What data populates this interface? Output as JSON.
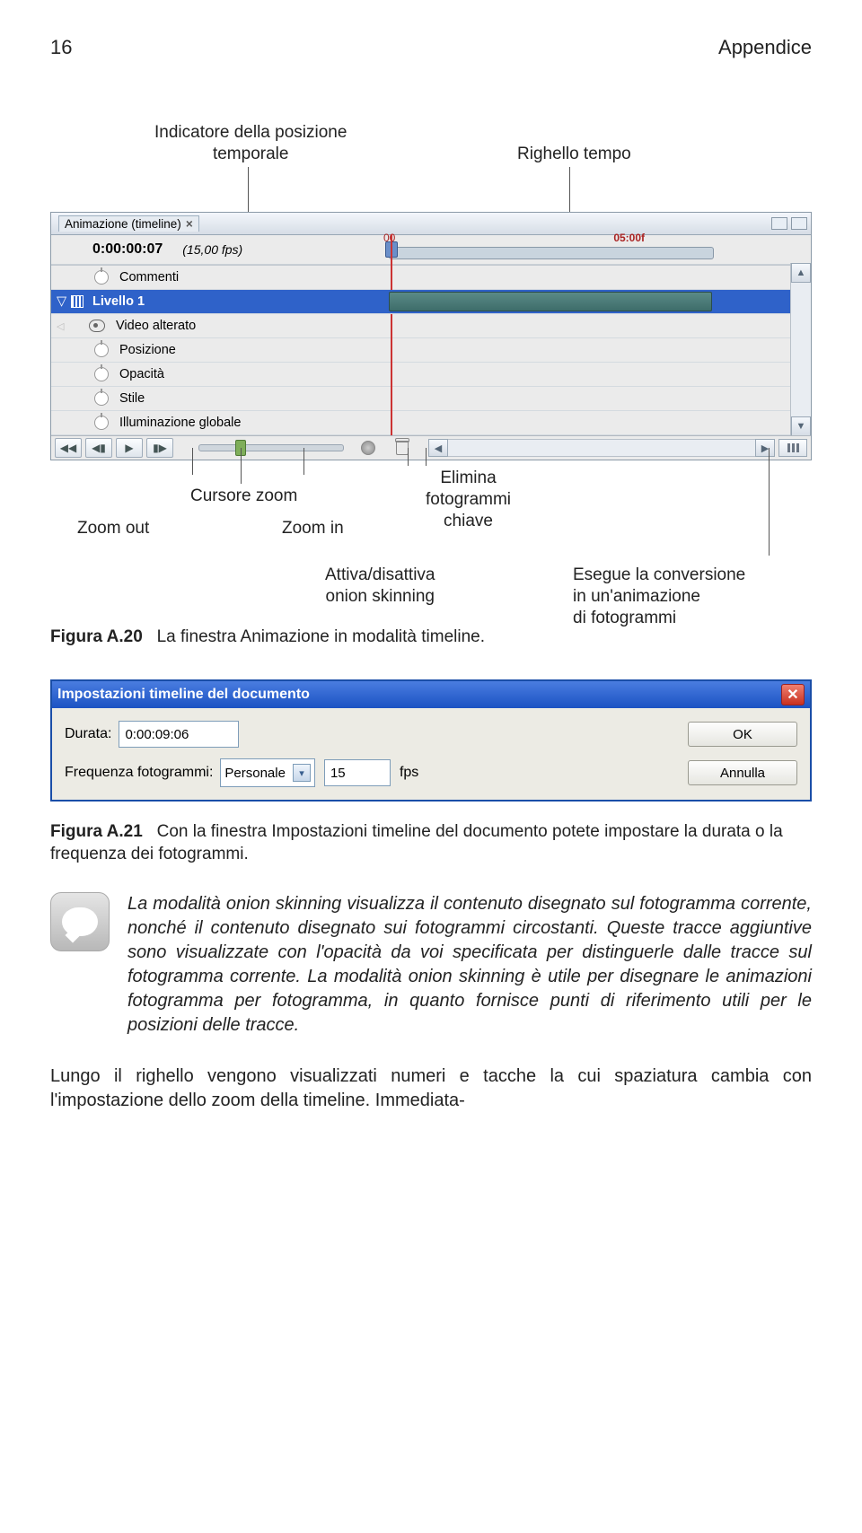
{
  "header": {
    "page_num": "16",
    "title": "Appendice"
  },
  "callouts_top": {
    "indicator": "Indicatore della posizione\ntemporale",
    "ruler": "Righello tempo"
  },
  "panel": {
    "tab_title": "Animazione (timeline)",
    "timecode": "0:00:00:07",
    "fps_label": "(15,00 fps)",
    "ruler": {
      "t0": "00",
      "t5": "05:00f"
    },
    "layers": [
      {
        "name": "Commenti",
        "type": "plain"
      },
      {
        "name": "Livello 1",
        "type": "selected"
      },
      {
        "name": "Video alterato",
        "type": "eye"
      },
      {
        "name": "Posizione",
        "type": "plain"
      },
      {
        "name": "Opacità",
        "type": "plain"
      },
      {
        "name": "Stile",
        "type": "plain"
      },
      {
        "name": "Illuminazione globale",
        "type": "plain"
      }
    ]
  },
  "callouts_bottom": {
    "zoom_out": "Zoom out",
    "cursor_zoom": "Cursore zoom",
    "zoom_in": "Zoom in",
    "elimina": "Elimina\nfotogrammi\nchiave",
    "attiva": "Attiva/disattiva\nonion skinning",
    "esegue": "Esegue la conversione\nin un'animazione\ndi fotogrammi"
  },
  "figure20": {
    "num": "Figura A.20",
    "caption": "La finestra Animazione in modalità timeline."
  },
  "dialog": {
    "title": "Impostazioni timeline del documento",
    "durata_label": "Durata:",
    "durata_value": "0:00:09:06",
    "freq_label": "Frequenza fotogrammi:",
    "freq_preset": "Personale",
    "freq_value": "15",
    "freq_unit": "fps",
    "ok": "OK",
    "cancel": "Annulla"
  },
  "figure21": {
    "num": "Figura A.21",
    "caption": "Con la finestra Impostazioni timeline del documento potete impostare la durata o la frequenza dei fotogrammi."
  },
  "note": "La modalità onion skinning visualizza il contenuto disegnato sul fotogramma corrente, nonché il contenuto disegnato sui fotogrammi circostanti. Queste tracce aggiuntive sono visualizzate con l'opacità da voi specificata per distinguerle dalle tracce sul fotogramma corrente. La modalità onion skinning è utile per disegnare le animazioni fotogramma per fotogramma, in quanto fornisce punti di riferimento utili per le posizioni delle tracce.",
  "paragraph": "Lungo il righello vengono visualizzati numeri e tacche la cui spaziatura cambia con l'impostazione dello zoom della timeline. Immediata-"
}
